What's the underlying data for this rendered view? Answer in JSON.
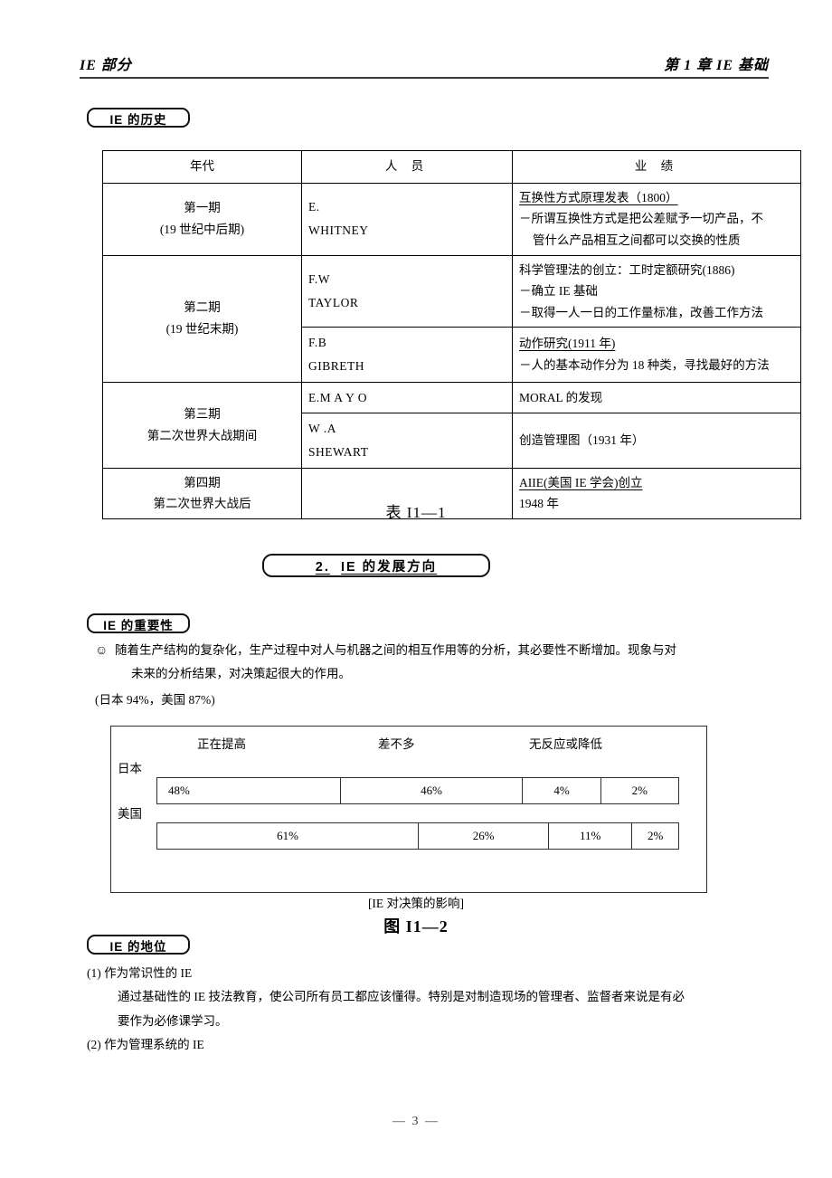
{
  "header": {
    "left_title": "IE 部分",
    "right_title": "第 1 章    IE 基础"
  },
  "badges": {
    "history": "IE 的历史",
    "importance": "IE 的重要性",
    "status": "IE 的地位",
    "section_number": "2.",
    "section_title": "IE 的发展方向"
  },
  "history_table": {
    "headers": [
      "年代",
      "人  员",
      "业  绩"
    ],
    "rows": [
      {
        "era": [
          "第一期",
          "(19 世纪中后期)"
        ],
        "person": [
          "E.",
          "WHITNEY"
        ],
        "achievement": [
          "互换性方式原理发表（1800）",
          "－所谓互换性方式是把公差赋予一切产品，不",
          "管什么产品相互之间都可以交换的性质"
        ]
      },
      {
        "era": [
          "第二期",
          "(19 世纪末期)"
        ],
        "person": [
          "F.W",
          "TAYLOR"
        ],
        "achievement": [
          "科学管理法的创立：工时定额研究(1886)",
          "－确立 IE 基础",
          "－取得一人一日的工作量标准，改善工作方法"
        ]
      },
      {
        "era": [],
        "person": [
          "F.B",
          "GIBRETH"
        ],
        "achievement": [
          "动作研究(1911 年)",
          "－人的基本动作分为 18 种类，寻找最好的方法"
        ]
      },
      {
        "era": [
          "第三期",
          "第二次世界大战期间"
        ],
        "person": [
          "E.M A Y O"
        ],
        "achievement": [
          "MORAL 的发现"
        ]
      },
      {
        "era": [],
        "person": [
          "W .A",
          "SHEWART"
        ],
        "achievement": [
          "创造管理图（1931 年）"
        ]
      },
      {
        "era": [
          "第四期",
          "第二次世界大战后"
        ],
        "person": [],
        "achievement": [
          "AIIE(美国 IE 学会)创立",
          "1948 年"
        ]
      }
    ]
  },
  "captions": {
    "table_1": "表 I1—1",
    "figure_2": "图 I1—2",
    "figure_2_sub": "[IE 对决策的影响]"
  },
  "importance": {
    "bullet_icon": "smiley-face-icon",
    "bullet_glyph": "☺",
    "line_1": "随着生产结构的复杂化，生产过程中对人与机器之间的相互作用等的分析，其必要性不断增加。现象与对",
    "line_2": "未来的分析结果，对决策起很大的作用。",
    "stat_line": "(日本  94%，美国  87%)"
  },
  "chart_data": {
    "type": "bar",
    "title": "[IE 对决策的影响]",
    "subtitle": "图 I1—2",
    "orientation": "horizontal-stacked",
    "categories": [
      "日本",
      "美国"
    ],
    "column_labels": [
      "正在提高",
      "差不多",
      "无反应或降低"
    ],
    "segment_labels": [
      "48%",
      "46%",
      "4%",
      "2%",
      "61%",
      "26%",
      "11%",
      "2%"
    ],
    "series": [
      {
        "name": "日本",
        "values": [
          48,
          46,
          4,
          2
        ],
        "labels": [
          "48%",
          "46%",
          "4%",
          "2%"
        ],
        "widths_pct": [
          35.2,
          35.0,
          15.0,
          14.8
        ]
      },
      {
        "name": "美国",
        "values": [
          61,
          26,
          11,
          2
        ],
        "labels": [
          "61%",
          "26%",
          "11%",
          "2%"
        ],
        "widths_pct": [
          50.2,
          25.0,
          16.0,
          8.8
        ]
      }
    ],
    "xlabel": "",
    "ylabel": "",
    "grid": false,
    "legend_position": "top"
  },
  "status": {
    "item_1": "(1) 作为常识性的 IE",
    "item_1_sub_1": "通过基础性的 IE 技法教育，使公司所有员工都应该懂得。特别是对制造现场的管理者、监督者来说是有必",
    "item_1_sub_2": "要作为必修课学习。",
    "item_2": "(2) 作为管理系统的 IE"
  },
  "footer": {
    "page_number": "— 3 —"
  }
}
